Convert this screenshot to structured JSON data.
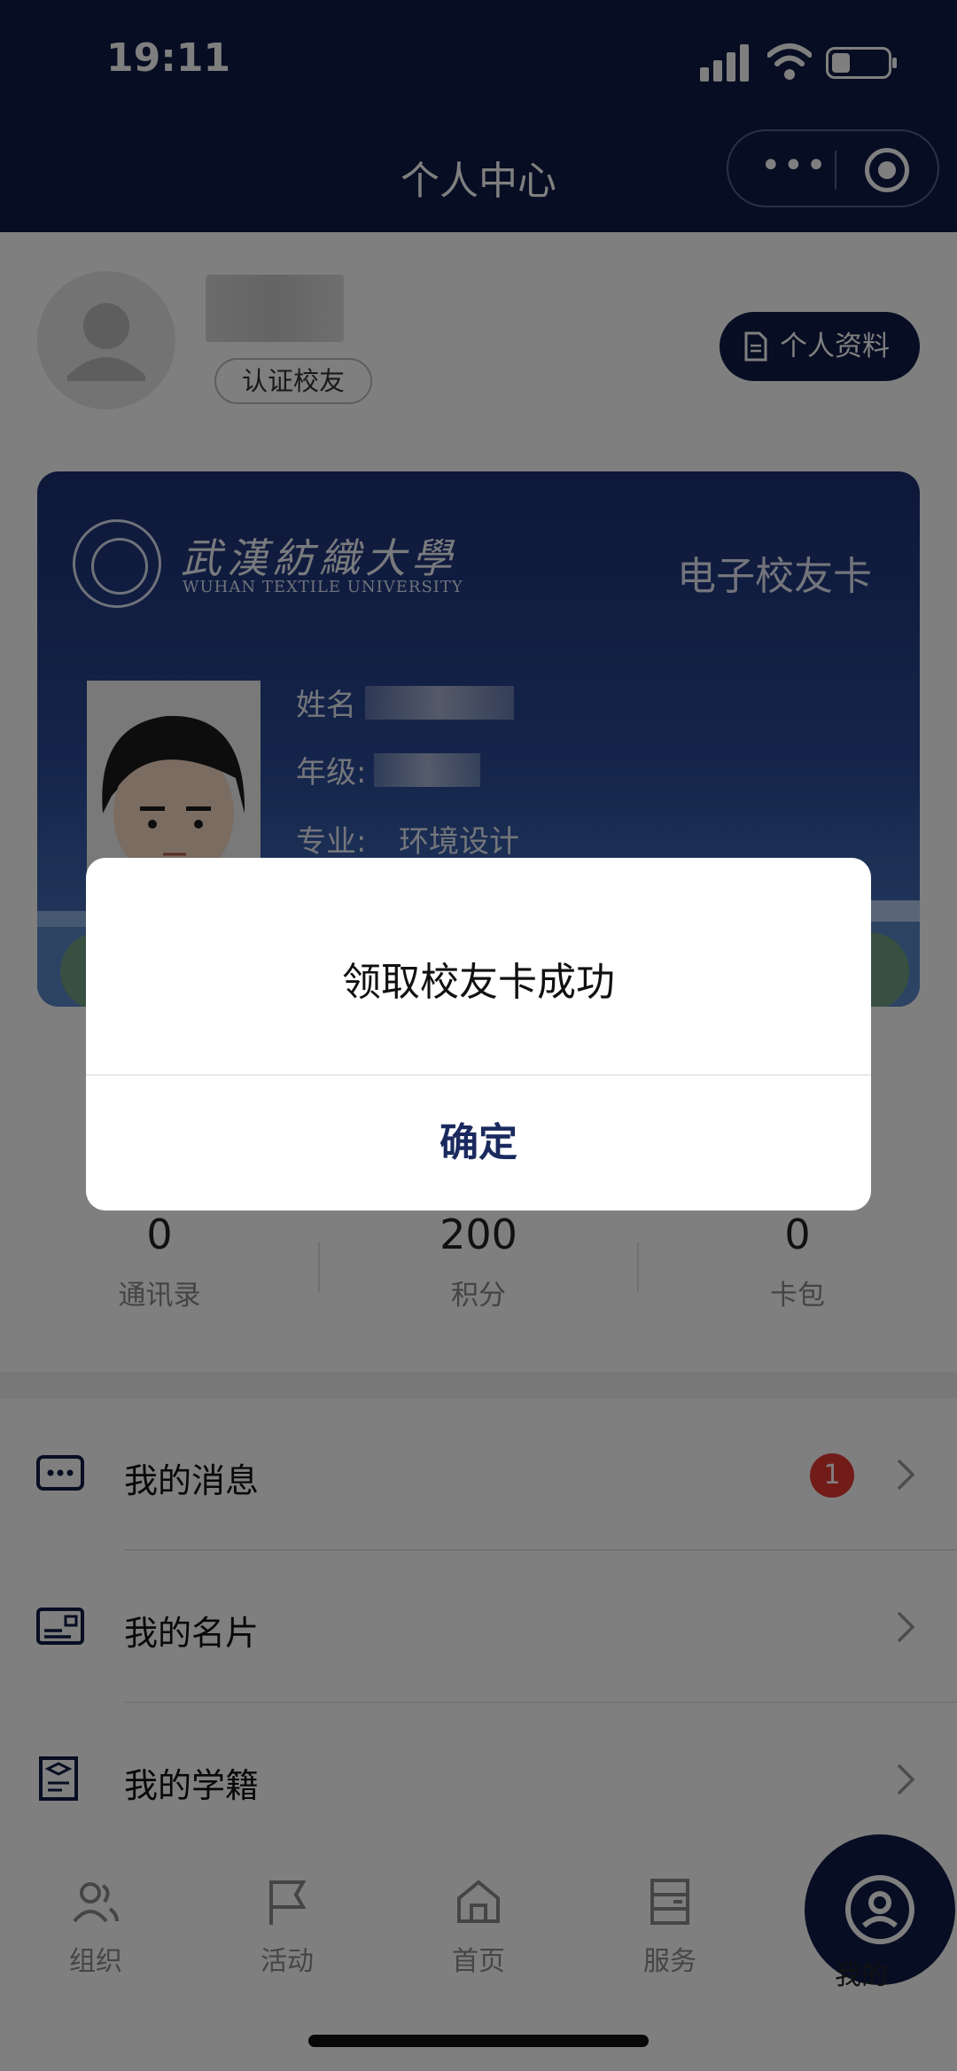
{
  "status_bar": {
    "time": "19:11"
  },
  "header": {
    "title": "个人中心"
  },
  "profile": {
    "badge": "认证校友",
    "profile_button": "个人资料"
  },
  "card": {
    "logo_cn": "武漢紡織大學",
    "logo_en": "WUHAN TEXTILE UNIVERSITY",
    "title": "电子校友卡",
    "fields": {
      "name_label": "姓名",
      "grade_label": "年级:",
      "major_label": "专业:",
      "major_value": "环境设计"
    }
  },
  "stats": [
    {
      "value": "0",
      "label": "通讯录"
    },
    {
      "value": "200",
      "label": "积分"
    },
    {
      "value": "0",
      "label": "卡包"
    }
  ],
  "menu": [
    {
      "label": "我的消息",
      "icon": "message-icon",
      "badge": "1"
    },
    {
      "label": "我的名片",
      "icon": "card-icon"
    },
    {
      "label": "我的学籍",
      "icon": "diploma-icon"
    }
  ],
  "tabbar": [
    {
      "label": "组织",
      "icon": "people-icon"
    },
    {
      "label": "活动",
      "icon": "flag-icon"
    },
    {
      "label": "首页",
      "icon": "home-icon"
    },
    {
      "label": "服务",
      "icon": "server-icon"
    },
    {
      "label": "我的",
      "icon": "profile-icon"
    }
  ],
  "modal": {
    "message": "领取校友卡成功",
    "confirm": "确定"
  },
  "colors": {
    "brand": "#0f1c47",
    "badge": "#e53935",
    "confirm_text": "#1b2a5e"
  }
}
